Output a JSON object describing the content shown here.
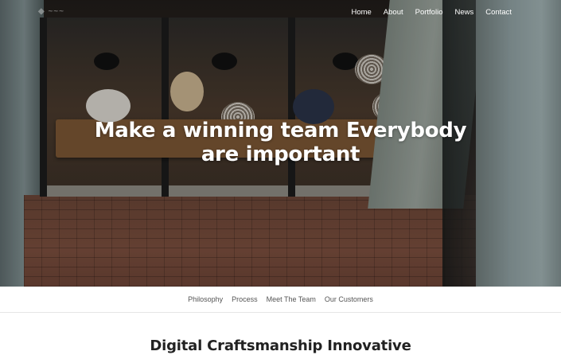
{
  "nav": {
    "items": [
      {
        "label": "Home"
      },
      {
        "label": "About"
      },
      {
        "label": "Portfolio"
      },
      {
        "label": "News"
      },
      {
        "label": "Contact"
      }
    ]
  },
  "hero": {
    "title_line1": "Make a winning team Everybody",
    "title_line2": "are important"
  },
  "subnav": {
    "items": [
      {
        "label": "Philosophy"
      },
      {
        "label": "Process"
      },
      {
        "label": "Meet The Team"
      },
      {
        "label": "Our Customers"
      }
    ]
  },
  "section": {
    "title": "Digital Craftsmanship Innovative"
  },
  "colors": {
    "nav_text": "#ffffff",
    "heading": "#222222",
    "subnav_text": "#555555"
  }
}
